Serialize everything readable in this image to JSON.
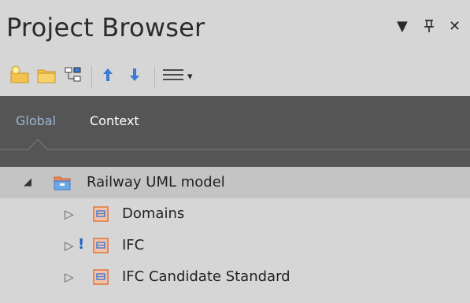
{
  "window": {
    "title": "Project Browser",
    "controls": {
      "dropdown_glyph": "▼",
      "pin_glyph": "ᵽ",
      "close_glyph": "✕"
    }
  },
  "toolbar": {
    "buttons": [
      {
        "name": "new-model-button",
        "icon": "folder-star-icon"
      },
      {
        "name": "new-folder-button",
        "icon": "folder-icon"
      },
      {
        "name": "structure-button",
        "icon": "hierarchy-icon"
      },
      {
        "name": "move-up-button",
        "icon": "arrow-up-icon"
      },
      {
        "name": "move-down-button",
        "icon": "arrow-down-icon"
      },
      {
        "name": "menu-button",
        "icon": "hamburger-icon"
      }
    ],
    "menu_caret": "▾"
  },
  "tabs": [
    {
      "label": "Global",
      "active": true
    },
    {
      "label": "Context",
      "active": false
    }
  ],
  "tree": {
    "root": {
      "label": "Railway UML model",
      "expander": "◢"
    },
    "children": [
      {
        "label": "Domains",
        "expander": "▷",
        "flag": ""
      },
      {
        "label": "IFC",
        "expander": "▷",
        "flag": "!"
      },
      {
        "label": "IFC Candidate Standard",
        "expander": "▷",
        "flag": ""
      }
    ]
  },
  "colors": {
    "accent_blue": "#3a7bd5",
    "folder_yellow": "#f2c24c",
    "package_orange": "#e8895a",
    "tab_active": "#9ab7d3",
    "tab_inactive": "#ffffff"
  }
}
